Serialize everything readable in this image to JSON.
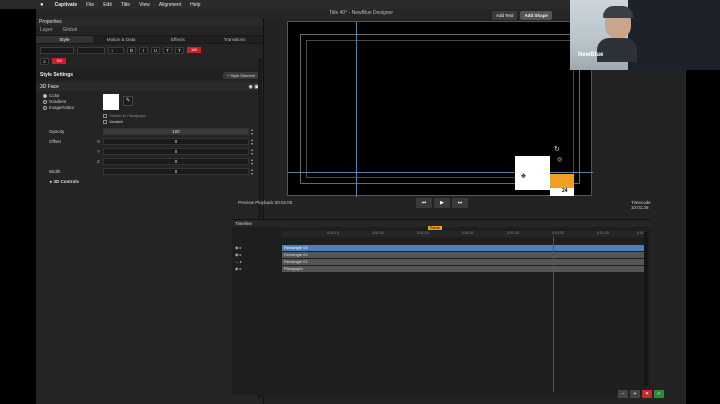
{
  "menubar": {
    "apple": "",
    "items": [
      "Captivate",
      "File",
      "Edit",
      "Title",
      "View",
      "Alignment",
      "Help"
    ]
  },
  "window": {
    "title": "Title 40* - NewBlue Designer"
  },
  "left_panel": {
    "header": "Properties",
    "layer_tabs": [
      "Layer",
      "Global"
    ],
    "sub_tabs": [
      "Style",
      "Motion & Data",
      "Effects",
      "Transitions"
    ],
    "font_size": "1",
    "format_buttons": [
      "B",
      "I",
      "U",
      "T",
      "T"
    ],
    "color_a": "100",
    "color_b": "100",
    "style_settings": {
      "title": "Style Settings",
      "button": "+ Style Element"
    },
    "section": {
      "title": "3D Face"
    },
    "fill_types": [
      "Color",
      "Gradient",
      "Image/Video"
    ],
    "stretch_label": "Stretch to Paragraph",
    "variable_label": "Variable",
    "opacity": {
      "label": "Opacity",
      "value": "100"
    },
    "offset": {
      "label": "Offset",
      "x_axis": "X",
      "x": "0",
      "y_axis": "Y",
      "y": "0",
      "z_axis": "Z",
      "z": "0"
    },
    "width": {
      "label": "Width",
      "value": "0"
    },
    "controls_3d": "3D Controls"
  },
  "top_buttons": {
    "add_text": "Add Text",
    "add_shape": "Add Shape"
  },
  "canvas": {
    "date_label": "24"
  },
  "preview": {
    "label": "Preview Playback",
    "time": "00:02;00",
    "timecode_label": "Timecode",
    "timecode": "10:01;28"
  },
  "timeline": {
    "header": "Timeline",
    "ruler_ticks": [
      "0:00:15",
      "0:01:00",
      "0:01:15",
      "0:01:01",
      "0:01:15",
      "0:02:00",
      "0:01:15",
      "0:01:00",
      "0:01"
    ],
    "pause_marker": "Pause",
    "tracks": [
      {
        "name": "Rectangle 04",
        "selected": true
      },
      {
        "name": "Rectangle 03",
        "selected": false
      },
      {
        "name": "Rectangle 01",
        "selected": false
      },
      {
        "name": "Paragraph",
        "selected": false
      }
    ]
  },
  "bottom_buttons": [
    "−",
    "+",
    "✕",
    "✓"
  ],
  "webcam": {
    "label": "NewBlue"
  },
  "colors": {
    "accent_red": "#c8202a",
    "selection_blue": "#4d7fbf",
    "orange": "#f0a020",
    "playhead": "#cc2222"
  }
}
